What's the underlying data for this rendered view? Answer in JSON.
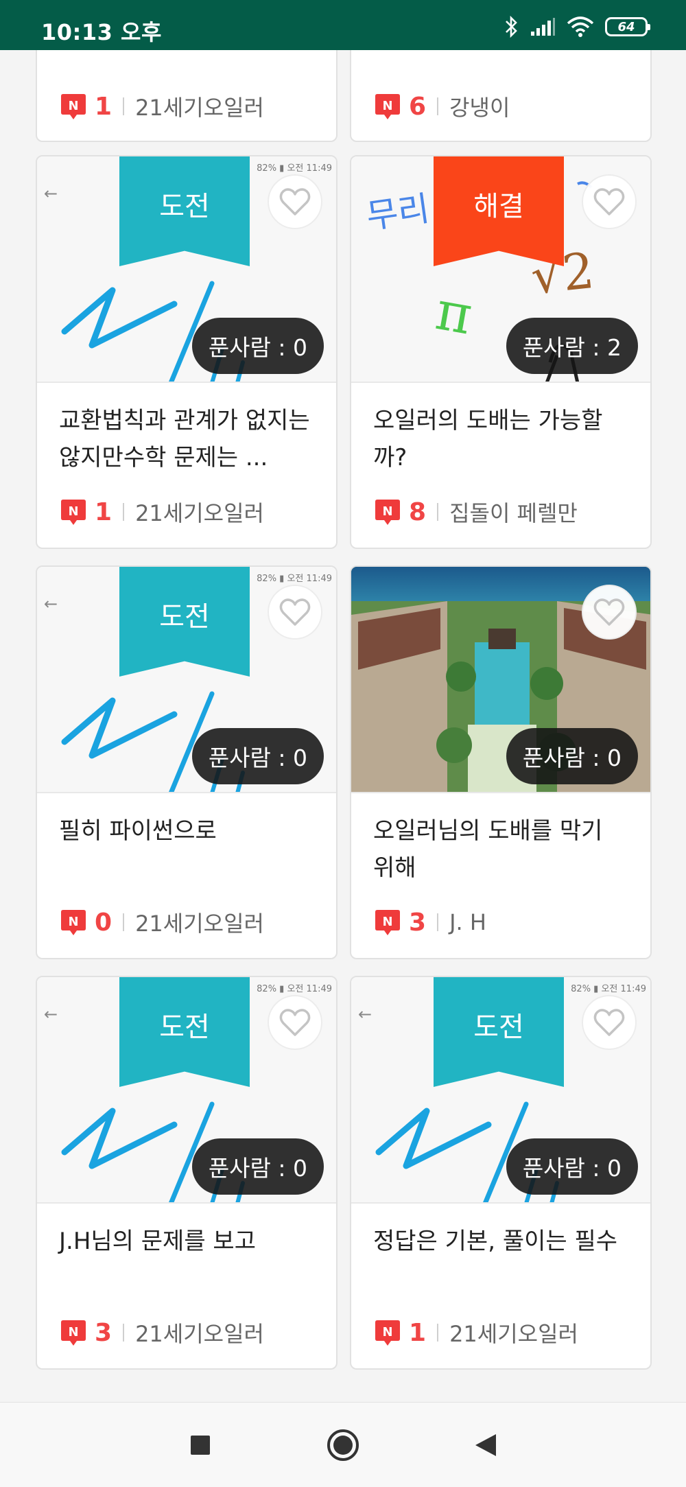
{
  "status_bar": {
    "time": "10:13 오후",
    "battery": "64"
  },
  "top_cards": [
    {
      "count": "1",
      "author": "21세기오일러"
    },
    {
      "count": "6",
      "author": "강냉이"
    }
  ],
  "cards": [
    {
      "badge": "도전",
      "badge_type": "challenge",
      "solver_label": "푼사람 : 0",
      "title": "교환법칙과 관계가 없지는 않지만수학 문제는 ...",
      "count": "1",
      "author": "21세기오일러",
      "thumb": "sketch",
      "mini_status": "82% ▮ 오전 11:49"
    },
    {
      "badge": "해결",
      "badge_type": "solved",
      "solver_label": "푼사람 : 2",
      "title": "오일러의 도배는 가능할까?",
      "count": "8",
      "author": "집돌이 페렐만",
      "thumb": "math",
      "math_words": [
        "무리",
        "π",
        "√2"
      ]
    },
    {
      "badge": "도전",
      "badge_type": "challenge",
      "solver_label": "푼사람 : 0",
      "title": "필히 파이썬으로",
      "count": "0",
      "author": "21세기오일러",
      "thumb": "sketch",
      "mini_status": "82% ▮ 오전 11:49"
    },
    {
      "badge": "",
      "badge_type": "none",
      "solver_label": "푼사람 : 0",
      "title": "오일러님의 도배를 막기 위해",
      "count": "3",
      "author": "J. H",
      "thumb": "resort"
    },
    {
      "badge": "도전",
      "badge_type": "challenge",
      "solver_label": "푼사람 : 0",
      "title": "J.H님의 문제를 보고",
      "count": "3",
      "author": "21세기오일러",
      "thumb": "sketch",
      "mini_status": "82% ▮ 오전 11:49"
    },
    {
      "badge": "도전",
      "badge_type": "challenge",
      "solver_label": "푼사람 : 0",
      "title": "정답은 기본, 풀이는 필수",
      "count": "1",
      "author": "21세기오일러",
      "thumb": "sketch",
      "mini_status": "82% ▮ 오전 11:49"
    }
  ],
  "icons": {
    "new_badge": "N",
    "heart": "heart-outline-icon"
  },
  "colors": {
    "status_bar": "#045c48",
    "challenge": "#21b4c3",
    "solved": "#fa4519",
    "count": "#f04545"
  }
}
